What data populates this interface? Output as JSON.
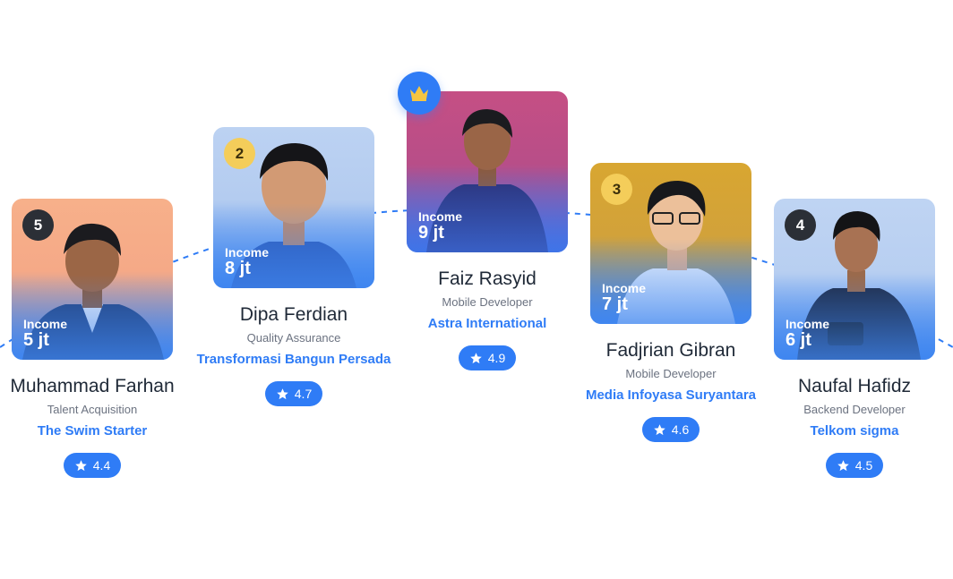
{
  "cards": [
    {
      "rank": "5",
      "income_label": "Income",
      "income": "5 jt",
      "name": "Muhammad Farhan",
      "role": "Talent Acquisition",
      "company": "The Swim Starter",
      "rating": "4.4",
      "photo_colors": [
        "#f7b08a",
        "#3f86f0"
      ]
    },
    {
      "rank": "2",
      "income_label": "Income",
      "income": "8 jt",
      "name": "Dipa Ferdian",
      "role": "Quality Assurance",
      "company": "Transformasi Bangun Persada",
      "rating": "4.7",
      "photo_colors": [
        "#b9d0f1",
        "#3f86f0"
      ]
    },
    {
      "rank": "crown",
      "income_label": "Income",
      "income": "9 jt",
      "name": "Faiz Rasyid",
      "role": "Mobile Developer",
      "company": "Astra International",
      "rating": "4.9",
      "photo_colors": [
        "#c54f84",
        "#3f74e8"
      ]
    },
    {
      "rank": "3",
      "income_label": "Income",
      "income": "7 jt",
      "name": "Fadjrian Gibran",
      "role": "Mobile Developer",
      "company": "Media Infoyasa Suryantara",
      "rating": "4.6",
      "photo_colors": [
        "#d6a532",
        "#3f86f0"
      ]
    },
    {
      "rank": "4",
      "income_label": "Income",
      "income": "6 jt",
      "name": "Naufal Hafidz",
      "role": "Backend Developer",
      "company": "Telkom sigma",
      "rating": "4.5",
      "photo_colors": [
        "#b9d0f1",
        "#3f86f0"
      ]
    }
  ],
  "icons": {
    "rating": "star-icon",
    "top_rank": "crown-icon"
  },
  "colors": {
    "accent": "#2f7cf6",
    "rank_dark": "#2b2f36",
    "rank_gold": "#f4cd5a",
    "crown": "#f5c542"
  }
}
